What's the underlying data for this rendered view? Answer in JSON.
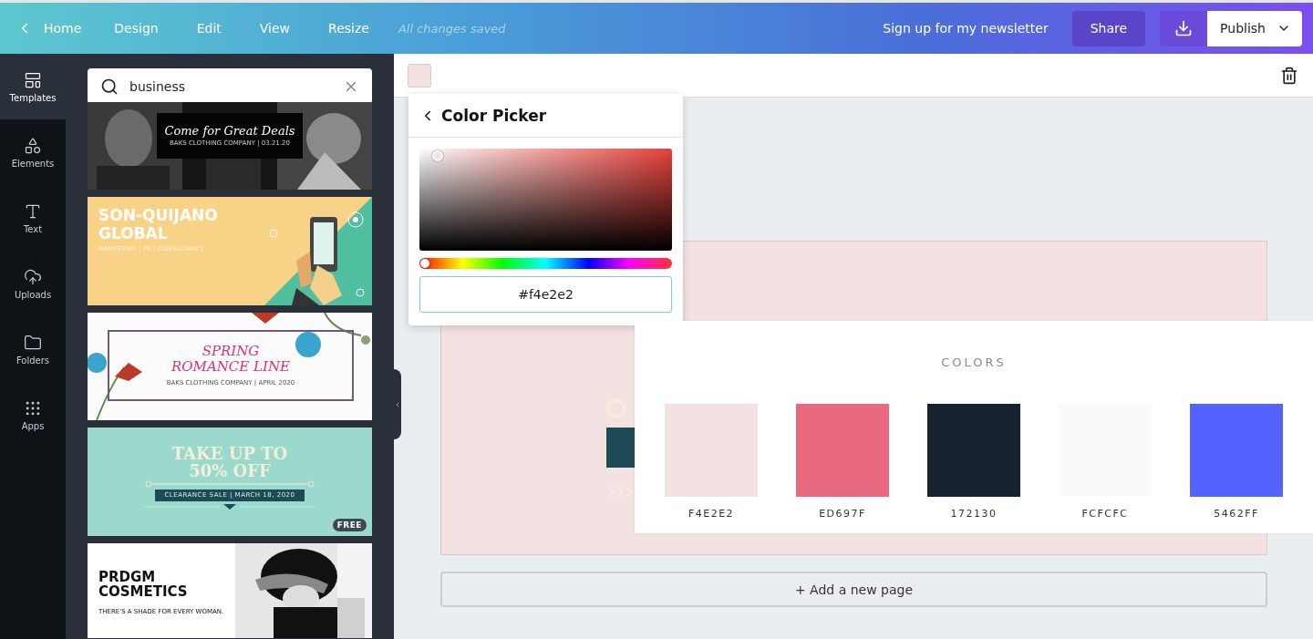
{
  "topbar": {
    "back": "Home",
    "menu": [
      "Design",
      "Edit",
      "View",
      "Resize"
    ],
    "status": "All changes saved",
    "newsletter": "Sign up for my newsletter",
    "share": "Share",
    "publish": "Publish"
  },
  "rail": [
    {
      "kind": "templates",
      "label": "Templates",
      "selected": true
    },
    {
      "kind": "elements",
      "label": "Elements",
      "selected": false
    },
    {
      "kind": "text",
      "label": "Text",
      "selected": false
    },
    {
      "kind": "uploads",
      "label": "Uploads",
      "selected": false
    },
    {
      "kind": "folders",
      "label": "Folders",
      "selected": false
    },
    {
      "kind": "apps",
      "label": "Apps",
      "selected": false
    }
  ],
  "search": {
    "value": "business"
  },
  "templates": [
    {
      "kind": "photo-deals",
      "title": "Come for Great Deals",
      "subtitle": "BAKS CLOTHING COMPANY | 03.21.20"
    },
    {
      "kind": "phone",
      "title": "SON-QUIJANO",
      "title2": "GLOBAL",
      "subtitle": "MARKETING | PR | CONSULTANCY"
    },
    {
      "kind": "floral",
      "title": "SPRING",
      "title2": "ROMANCE LINE",
      "subtitle": "BAKS CLOTHING COMPANY | APRIL 2020"
    },
    {
      "kind": "sale",
      "title": "TAKE UP TO",
      "title2": "50% OFF",
      "subtitle": "CLEARANCE SALE | MARCH 18, 2020",
      "badge": "FREE"
    },
    {
      "kind": "cosmetics",
      "title": "PRDGM",
      "title2": "COSMETICS",
      "subtitle": "THERE'S A SHADE FOR EVERY WOMAN."
    }
  ],
  "toolbar": {
    "color": "#f4e2e2"
  },
  "color_picker": {
    "title": "Color Picker",
    "hex": "#f4e2e2",
    "hue": {
      "level": 0
    }
  },
  "colors_panel": {
    "title": "COLORS",
    "swatches": [
      {
        "label": "F4E2E2",
        "color": "#f4e2e2"
      },
      {
        "label": "ED697F",
        "color": "#e9697f"
      },
      {
        "label": "172130",
        "color": "#172130"
      },
      {
        "label": "FCFCFC",
        "color": "#fafafa"
      },
      {
        "label": "5462FF",
        "color": "#5462ff"
      }
    ]
  },
  "canvas": {
    "add_page": "+ Add a new page"
  }
}
